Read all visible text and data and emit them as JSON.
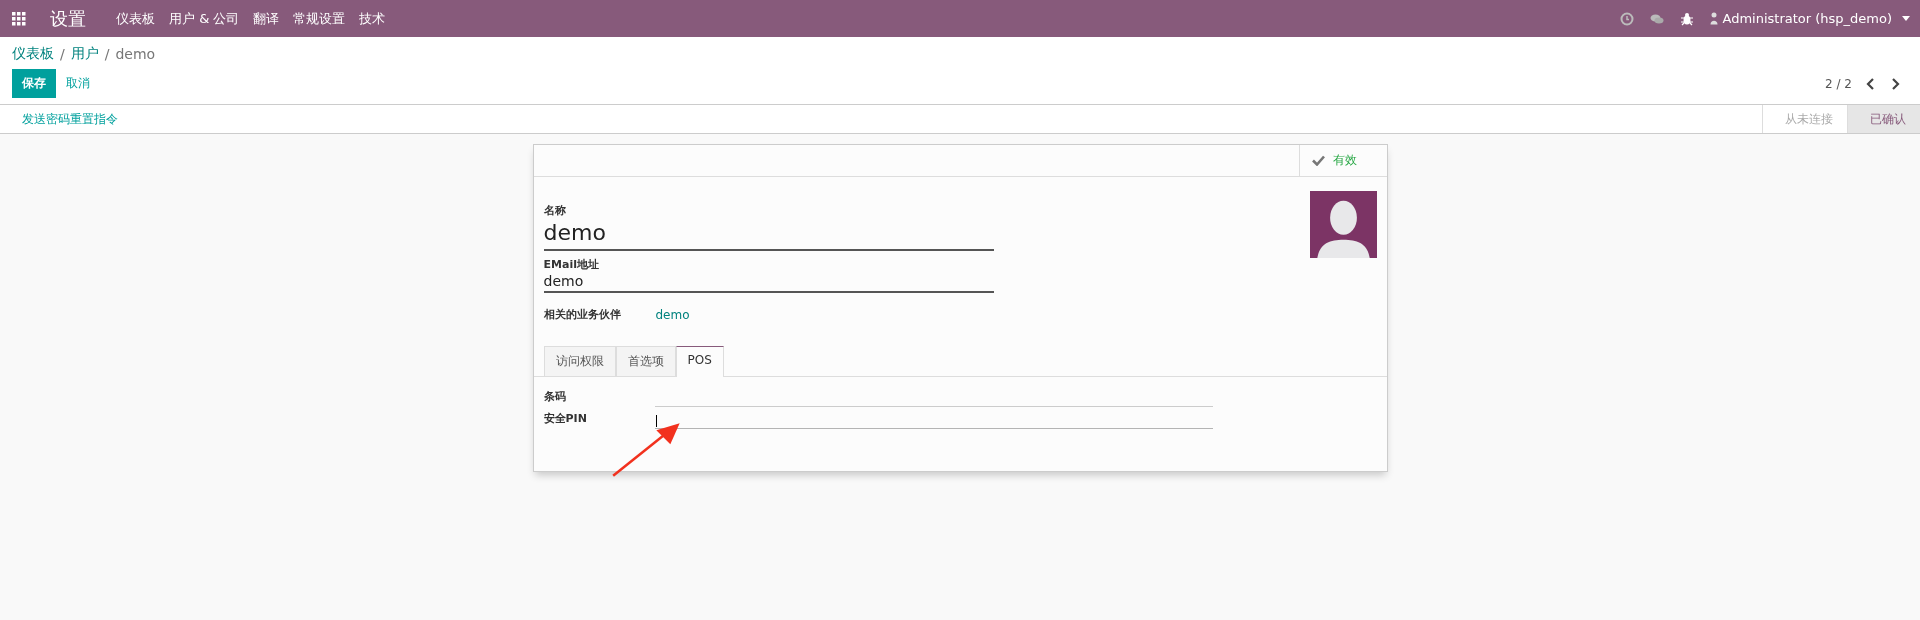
{
  "navbar": {
    "app_title": "设置",
    "menu": [
      "仪表板",
      "用户 & 公司",
      "翻译",
      "常规设置",
      "技术"
    ],
    "user": "Administrator (hsp_demo)"
  },
  "breadcrumb": [
    {
      "label": "仪表板",
      "kind": "link"
    },
    {
      "label": "/",
      "kind": "separator"
    },
    {
      "label": "用户",
      "kind": "link"
    },
    {
      "label": "/",
      "kind": "separator"
    },
    {
      "label": "demo",
      "kind": "current"
    }
  ],
  "buttons": {
    "save": "保存",
    "cancel": "取消"
  },
  "pager": "2 / 2",
  "statusbar": {
    "action": "发送密码重置指令",
    "stages": [
      {
        "label": "从未连接",
        "selected": false
      },
      {
        "label": "已确认",
        "selected": true
      }
    ]
  },
  "form": {
    "active_button": {
      "label": "有效",
      "on": true
    },
    "name_label": "名称",
    "name": "demo",
    "email_label": "EMail地址",
    "email": "demo",
    "partner_label": "相关的业务伙伴",
    "partner": "demo",
    "tabs": [
      {
        "label": "访问权限",
        "selected": false
      },
      {
        "label": "首选项",
        "selected": false
      },
      {
        "label": "POS",
        "selected": true
      }
    ],
    "fields": [
      {
        "label": "条码",
        "focused": false
      },
      {
        "label": "安全PIN",
        "focused": true
      }
    ]
  }
}
